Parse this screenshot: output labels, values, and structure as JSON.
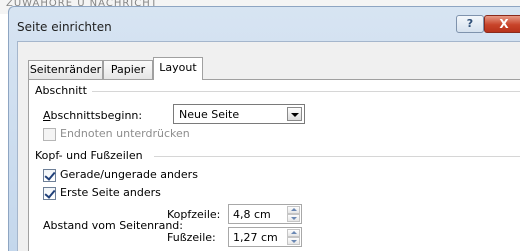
{
  "background": {
    "scrap_text": "ZUWAHÖRE Ü NACHRICHT"
  },
  "window": {
    "title": "Seite einrichten",
    "help_label": "?",
    "close_label": "X"
  },
  "tabs": [
    {
      "label": "Seitenränder",
      "active": false
    },
    {
      "label": "Papier",
      "active": false
    },
    {
      "label": "Layout",
      "active": true
    }
  ],
  "sections": {
    "abschnitt": {
      "title": "Abschnitt",
      "start_label": "Abschnittsbeginn:",
      "start_value": "Neue Seite",
      "endnotes_label": "Endnoten unterdrücken",
      "endnotes_checked": false,
      "endnotes_enabled": false
    },
    "kopf_fuss": {
      "title": "Kopf- und Fußzeilen",
      "odd_even_label": "Gerade/ungerade anders",
      "odd_even_checked": true,
      "first_page_label": "Erste Seite anders",
      "first_page_checked": true,
      "distance_label": "Abstand vom Seitenrand:",
      "header_label": "Kopfzeile:",
      "header_value": "4,8 cm",
      "footer_label": "Fußzeile:",
      "footer_value": "1,27 cm"
    }
  }
}
